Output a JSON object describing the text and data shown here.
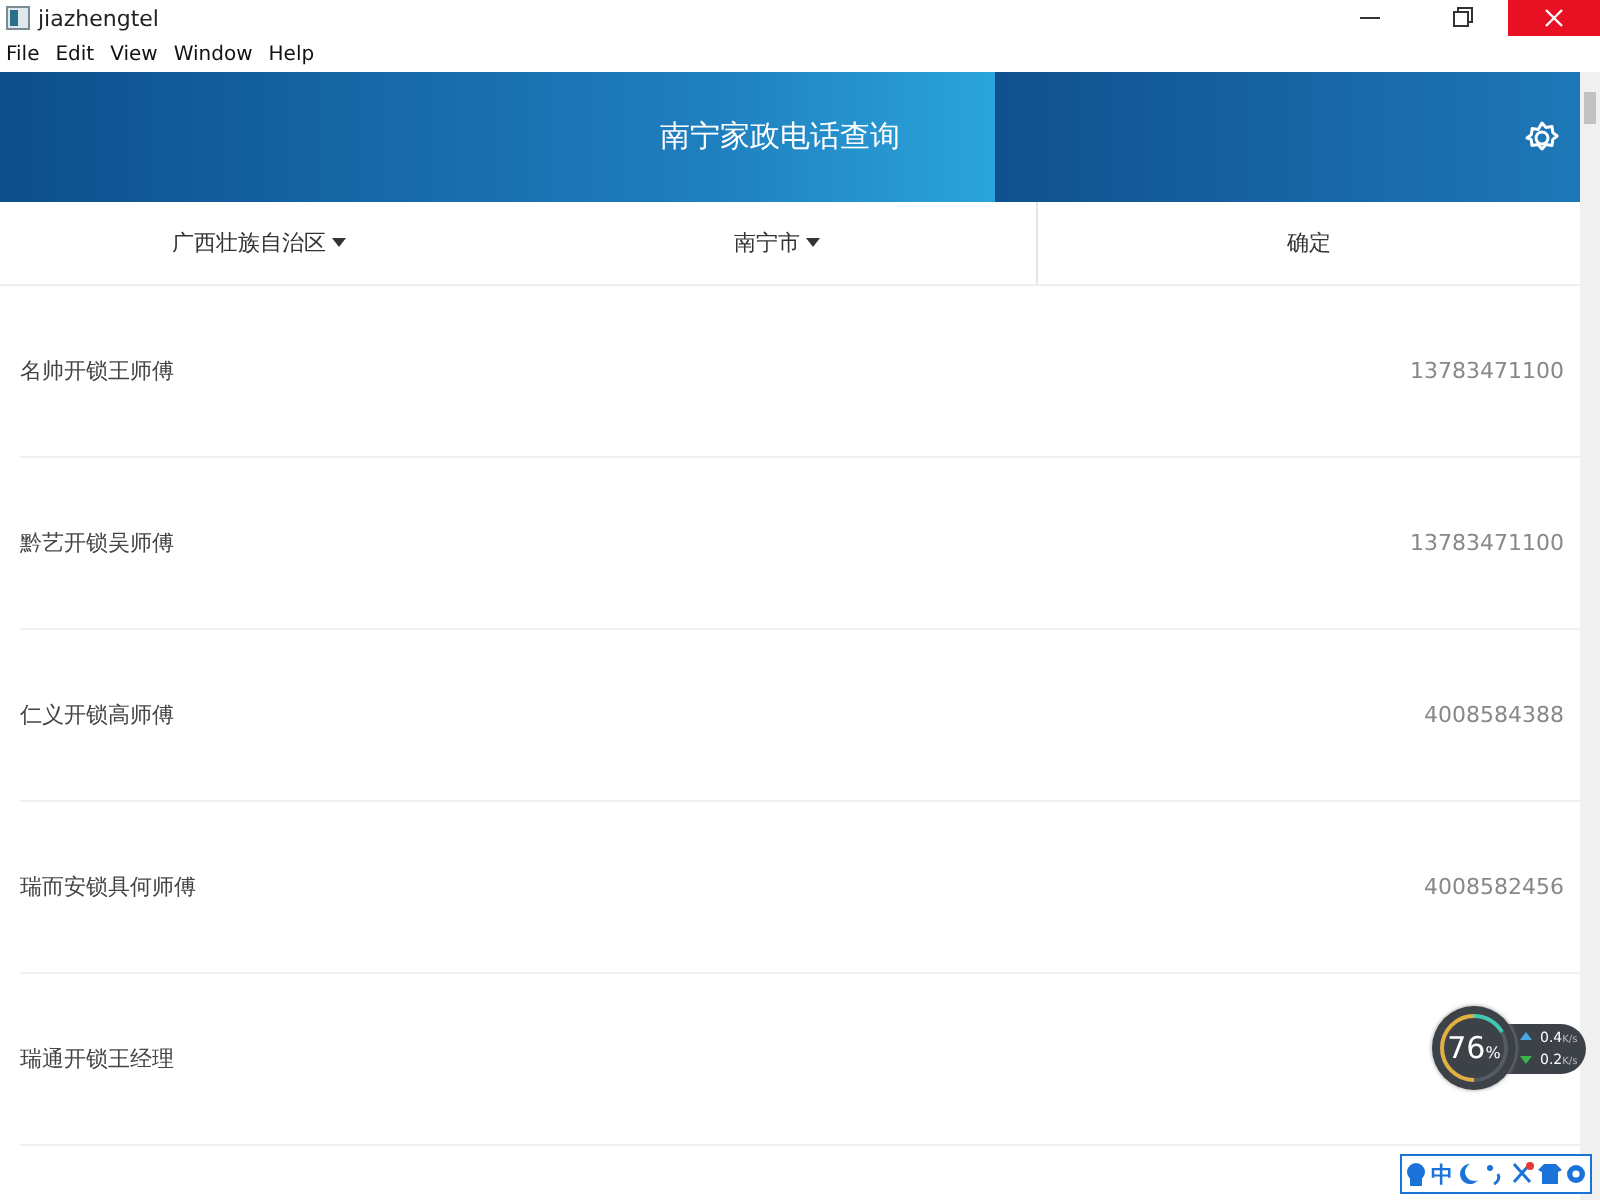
{
  "window": {
    "title": "jiazhengtel"
  },
  "menu": [
    "File",
    "Edit",
    "View",
    "Window",
    "Help"
  ],
  "header": {
    "title": "南宁家政电话查询"
  },
  "filters": [
    {
      "label": "广西壮族自治区",
      "kind": "dropdown"
    },
    {
      "label": "南宁市",
      "kind": "dropdown"
    },
    {
      "label": "确定",
      "kind": "button"
    }
  ],
  "listings": [
    {
      "name": "名帅开锁王师傅",
      "phone": "13783471100"
    },
    {
      "name": "黔艺开锁吴师傅",
      "phone": "13783471100"
    },
    {
      "name": "仁义开锁高师傅",
      "phone": "4008584388"
    },
    {
      "name": "瑞而安锁具何师傅",
      "phone": "4008582456"
    },
    {
      "name": "瑞通开锁王经理"
    }
  ],
  "speed_widget": {
    "percent": "76",
    "unit": "%",
    "upload": {
      "value": "0.4",
      "unit": "K/s"
    },
    "download": {
      "value": "0.2",
      "unit": "K/s"
    }
  },
  "ime_toolbar": {
    "mode": "中"
  }
}
